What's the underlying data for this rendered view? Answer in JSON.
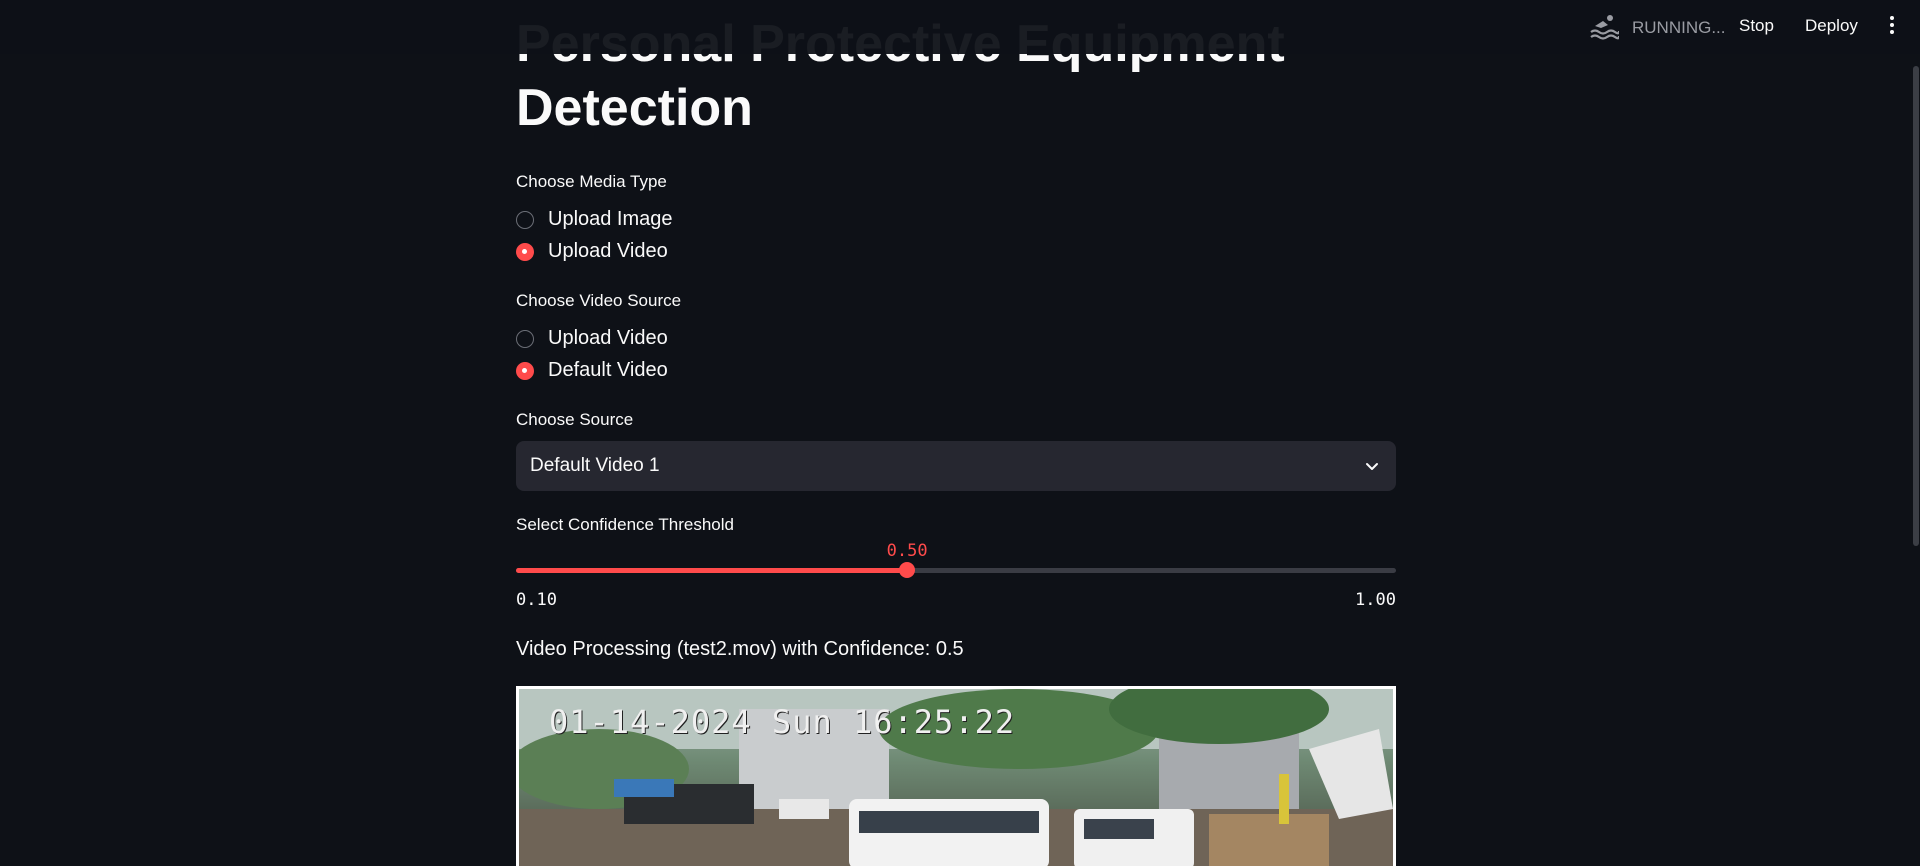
{
  "header": {
    "status_icon": "swimmer-icon",
    "status_text": "RUNNING...",
    "stop_label": "Stop",
    "deploy_label": "Deploy",
    "menu_icon": "vertical-dots-icon"
  },
  "page": {
    "title": "Personal Protective Equipment Detection"
  },
  "media_type": {
    "label": "Choose Media Type",
    "options": [
      "Upload Image",
      "Upload Video"
    ],
    "selected": "Upload Video"
  },
  "video_source": {
    "label": "Choose Video Source",
    "options": [
      "Upload Video",
      "Default Video"
    ],
    "selected": "Default Video"
  },
  "source": {
    "label": "Choose Source",
    "value": "Default Video 1",
    "icon": "chevron-down-icon"
  },
  "confidence": {
    "label": "Select Confidence Threshold",
    "value": "0.50",
    "min": "0.10",
    "max": "1.00",
    "value_num": 0.5,
    "min_num": 0.1,
    "max_num": 1.0
  },
  "processing": {
    "caption": "Video Processing (test2.mov) with Confidence: 0.5",
    "frame_timestamp": "01-14-2024 Sun 16:25:22"
  },
  "colors": {
    "background": "#0e1117",
    "accent": "#ff4b4b",
    "select_bg": "#262730"
  }
}
